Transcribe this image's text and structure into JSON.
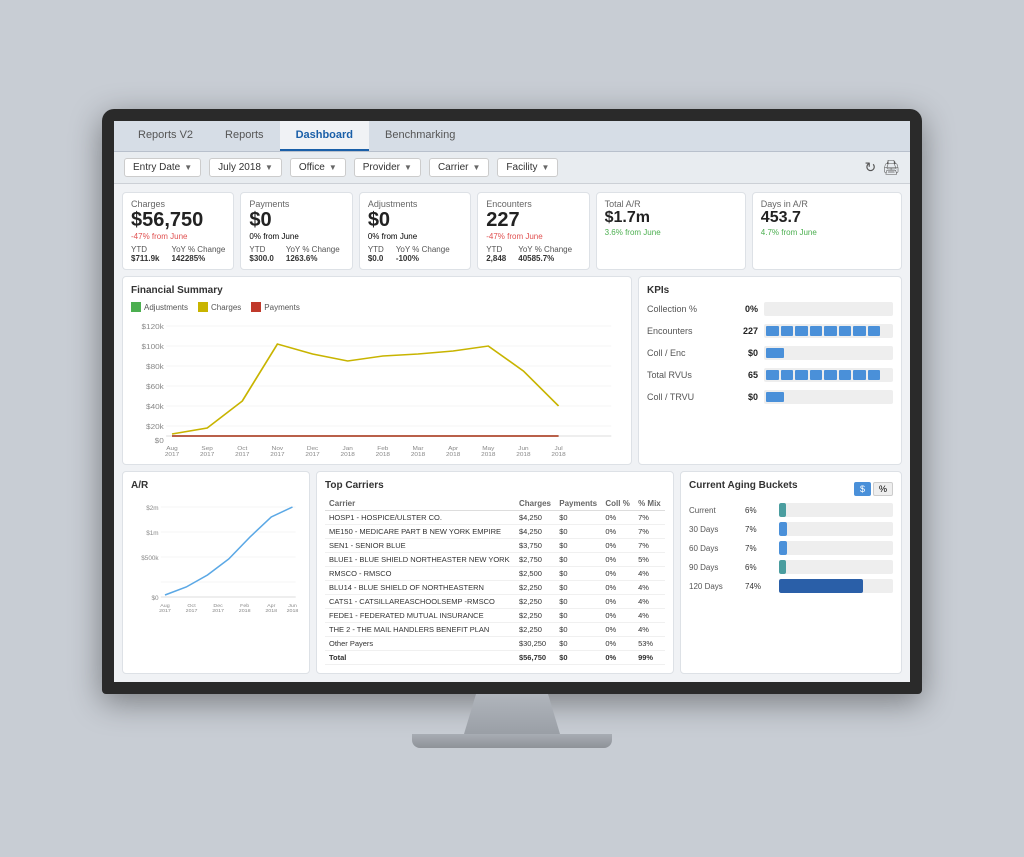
{
  "tabs": [
    {
      "label": "Reports V2",
      "active": false
    },
    {
      "label": "Reports",
      "active": false
    },
    {
      "label": "Dashboard",
      "active": true
    },
    {
      "label": "Benchmarking",
      "active": false
    }
  ],
  "filters": [
    {
      "label": "Entry Date",
      "value": ""
    },
    {
      "label": "July 2018",
      "value": ""
    },
    {
      "label": "Office",
      "value": ""
    },
    {
      "label": "Provider",
      "value": ""
    },
    {
      "label": "Carrier",
      "value": ""
    },
    {
      "label": "Facility",
      "value": ""
    }
  ],
  "metrics": {
    "charges": {
      "label": "Charges",
      "value": "$56,750",
      "change": "-47% from June",
      "change_type": "red",
      "ytd_label": "YTD",
      "ytd_value": "$711.9k",
      "yoy_label": "YoY % Change",
      "yoy_value": "142285%"
    },
    "payments": {
      "label": "Payments",
      "value": "$0",
      "change": "0% from June",
      "change_type": "neutral",
      "ytd_label": "YTD",
      "ytd_value": "$300.0",
      "yoy_label": "YoY % Change",
      "yoy_value": "1263.6%"
    },
    "adjustments": {
      "label": "Adjustments",
      "value": "$0",
      "change": "0% from June",
      "change_type": "neutral",
      "ytd_label": "YTD",
      "ytd_value": "$0.0",
      "yoy_label": "YoY % Change",
      "yoy_value": "-100%"
    },
    "encounters": {
      "label": "Encounters",
      "value": "227",
      "change": "-47% from June",
      "change_type": "red",
      "ytd_label": "YTD",
      "ytd_value": "2,848",
      "yoy_label": "YoY % Change",
      "yoy_value": "40585.7%"
    },
    "total_ar": {
      "label": "Total A/R",
      "value": "$1.7m",
      "change": "3.6% from June",
      "change_type": "green"
    },
    "days_ar": {
      "label": "Days in A/R",
      "value": "453.7",
      "change": "4.7% from June",
      "change_type": "green"
    }
  },
  "financial_summary": {
    "title": "Financial Summary",
    "legend": [
      {
        "label": "Adjustments",
        "color": "#4caf50"
      },
      {
        "label": "Charges",
        "color": "#c8b400"
      },
      {
        "label": "Payments",
        "color": "#c0392b"
      }
    ],
    "y_labels": [
      "$120k",
      "$100k",
      "$80k",
      "$60k",
      "$40k",
      "$20k",
      "$0"
    ],
    "x_labels": [
      "Aug\n2017",
      "Sep\n2017",
      "Oct\n2017",
      "Nov\n2017",
      "Dec\n2017",
      "Jan\n2018",
      "Feb\n2018",
      "Mar\n2018",
      "Apr\n2018",
      "May\n2018",
      "Jun\n2018",
      "Jul\n2018"
    ]
  },
  "kpis": {
    "title": "KPIs",
    "items": [
      {
        "label": "Collection %",
        "value": "0%",
        "pct": 0,
        "segments": 0
      },
      {
        "label": "Encounters",
        "value": "227",
        "pct": 70,
        "segments": 8
      },
      {
        "label": "Coll / Enc",
        "value": "$0",
        "pct": 15,
        "segments": 1
      },
      {
        "label": "Total RVUs",
        "value": "65",
        "pct": 65,
        "segments": 8
      },
      {
        "label": "Coll / TRVU",
        "value": "$0",
        "pct": 15,
        "segments": 1
      }
    ]
  },
  "ar_chart": {
    "title": "A/R",
    "y_labels": [
      "$2m",
      "$1m",
      "$500k",
      "$0"
    ],
    "x_labels": [
      "Aug\n2017",
      "Oct\n2017",
      "Dec\n2017",
      "Feb\n2018",
      "Apr\n2018",
      "Jun\n2018"
    ]
  },
  "carriers": {
    "title": "Top Carriers",
    "headers": [
      "Carrier",
      "Charges",
      "Payments",
      "Coll %",
      "% Mix"
    ],
    "rows": [
      [
        "HOSP1 - HOSPICE/ULSTER CO.",
        "$4,250",
        "$0",
        "0%",
        "7%"
      ],
      [
        "ME150 - MEDICARE PART B NEW YORK EMPIRE",
        "$4,250",
        "$0",
        "0%",
        "7%"
      ],
      [
        "SEN1 - SENIOR BLUE",
        "$3,750",
        "$0",
        "0%",
        "7%"
      ],
      [
        "BLUE1 - BLUE SHIELD NORTHEASTER NEW YORK",
        "$2,750",
        "$0",
        "0%",
        "5%"
      ],
      [
        "RMSCO - RMSCO",
        "$2,500",
        "$0",
        "0%",
        "4%"
      ],
      [
        "BLU14 - BLUE SHIELD OF NORTHEASTERN",
        "$2,250",
        "$0",
        "0%",
        "4%"
      ],
      [
        "CATS1 - CATSILLAREASCHOOLSEMP -RMSCO",
        "$2,250",
        "$0",
        "0%",
        "4%"
      ],
      [
        "FEDE1 - FEDERATED MUTUAL INSURANCE",
        "$2,250",
        "$0",
        "0%",
        "4%"
      ],
      [
        "THE 2 - THE MAIL HANDLERS BENEFIT PLAN",
        "$2,250",
        "$0",
        "0%",
        "4%"
      ],
      [
        "Other Payers",
        "$30,250",
        "$0",
        "0%",
        "53%"
      ],
      [
        "Total",
        "$56,750",
        "$0",
        "0%",
        "99%"
      ]
    ]
  },
  "aging": {
    "title": "Current Aging Buckets",
    "toggle": [
      "$",
      "%"
    ],
    "active_toggle": "$",
    "buckets": [
      {
        "label": "Current",
        "pct": "6%",
        "fill_pct": 6,
        "color": "teal"
      },
      {
        "label": "30 Days",
        "pct": "7%",
        "fill_pct": 7,
        "color": "blue"
      },
      {
        "label": "60 Days",
        "pct": "7%",
        "fill_pct": 7,
        "color": "blue"
      },
      {
        "label": "90 Days",
        "pct": "6%",
        "fill_pct": 6,
        "color": "teal"
      },
      {
        "label": "120 Days",
        "pct": "74%",
        "fill_pct": 74,
        "color": "dark-blue"
      }
    ]
  }
}
